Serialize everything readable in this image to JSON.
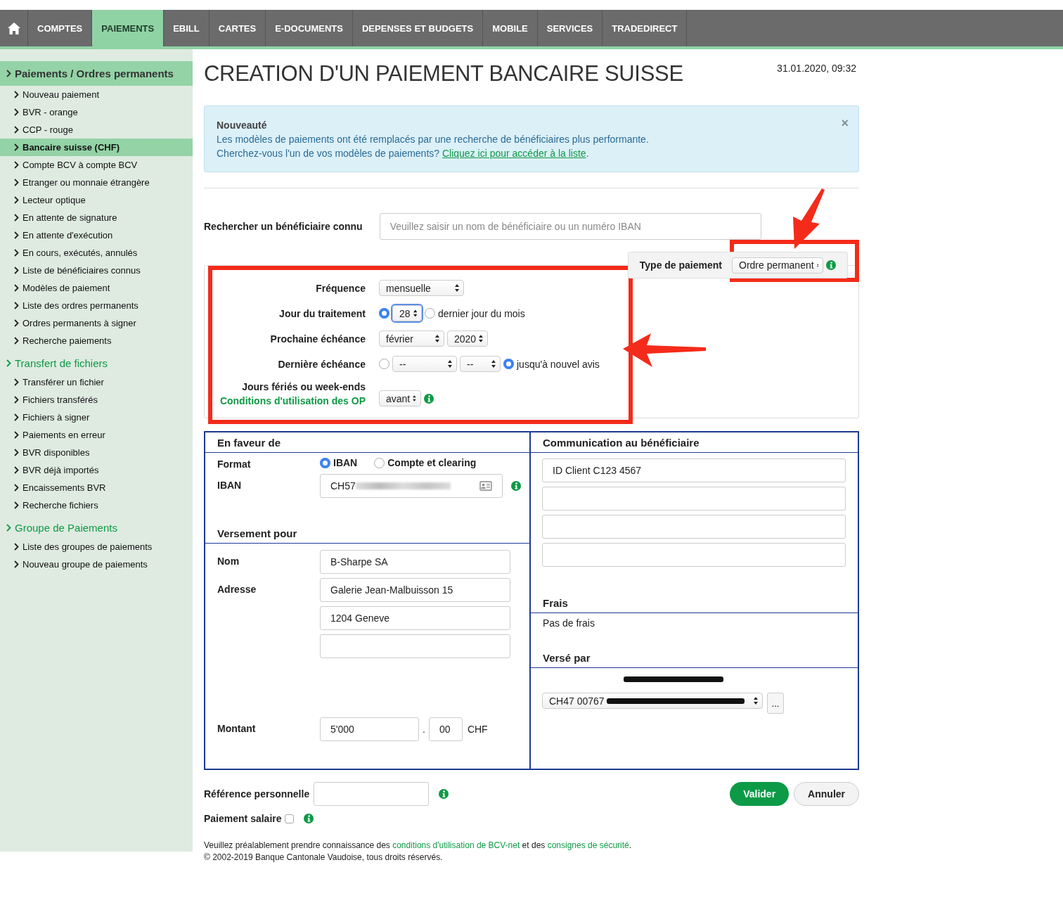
{
  "nav": {
    "items": [
      {
        "label": "COMPTES",
        "selected": false
      },
      {
        "label": "PAIEMENTS",
        "selected": true
      },
      {
        "label": "EBILL",
        "selected": false
      },
      {
        "label": "CARTES",
        "selected": false
      },
      {
        "label": "E-DOCUMENTS",
        "selected": false
      },
      {
        "label": "DEPENSES ET BUDGETS",
        "selected": false
      },
      {
        "label": "MOBILE",
        "selected": false
      },
      {
        "label": "SERVICES",
        "selected": false
      },
      {
        "label": "TRADEDIRECT",
        "selected": false
      }
    ]
  },
  "sidebar": {
    "sections": [
      {
        "title": "Paiements / Ordres permanents",
        "selected": true,
        "items": [
          {
            "label": "Nouveau paiement",
            "selected": false
          },
          {
            "label": "BVR - orange",
            "selected": false
          },
          {
            "label": "CCP - rouge",
            "selected": false
          },
          {
            "label": "Bancaire suisse (CHF)",
            "selected": true
          },
          {
            "label": "Compte BCV à compte BCV",
            "selected": false
          },
          {
            "label": "Etranger ou monnaie étrangère",
            "selected": false
          },
          {
            "label": "Lecteur optique",
            "selected": false
          },
          {
            "label": "En attente de signature",
            "selected": false
          },
          {
            "label": "En attente d'exécution",
            "selected": false
          },
          {
            "label": "En cours, exécutés, annulés",
            "selected": false
          },
          {
            "label": "Liste de bénéficiaires connus",
            "selected": false
          },
          {
            "label": "Modèles de paiement",
            "selected": false
          },
          {
            "label": "Liste des ordres permanents",
            "selected": false
          },
          {
            "label": "Ordres permanents à signer",
            "selected": false
          },
          {
            "label": "Recherche paiements",
            "selected": false
          }
        ]
      },
      {
        "title": "Transfert de fichiers",
        "selected": false,
        "items": [
          {
            "label": "Transférer un fichier",
            "selected": false
          },
          {
            "label": "Fichiers transférés",
            "selected": false
          },
          {
            "label": "Fichiers à signer",
            "selected": false
          },
          {
            "label": "Paiements en erreur",
            "selected": false
          },
          {
            "label": "BVR disponibles",
            "selected": false
          },
          {
            "label": "BVR déjà importés",
            "selected": false
          },
          {
            "label": "Encaissements BVR",
            "selected": false
          },
          {
            "label": "Recherche fichiers",
            "selected": false
          }
        ]
      },
      {
        "title": "Groupe de Paiements",
        "selected": false,
        "items": [
          {
            "label": "Liste des groupes de paiements",
            "selected": false
          },
          {
            "label": "Nouveau groupe de paiements",
            "selected": false
          }
        ]
      }
    ]
  },
  "page": {
    "title": "CREATION D'UN PAIEMENT BANCAIRE SUISSE",
    "timestamp": "31.01.2020, 09:32"
  },
  "notice": {
    "title": "Nouveauté",
    "line1": "Les modèles de paiements ont été remplacés par une recherche de bénéficiaires plus performante.",
    "line2": "Cherchez-vous l'un de vos modèles de paiements?",
    "link": "Cliquez ici pour accéder à la liste",
    "end": ".",
    "close": "×"
  },
  "search": {
    "label": "Rechercher un bénéficiaire connu",
    "placeholder": "Veuillez saisir un nom de bénéficiaire ou un numéro IBAN"
  },
  "payment_type": {
    "label": "Type de paiement",
    "value": "Ordre permanent"
  },
  "standing_order": {
    "frequency": {
      "label": "Fréquence",
      "value": "mensuelle"
    },
    "processing_day": {
      "label": "Jour du traitement",
      "day": {
        "selected": true,
        "value": "28"
      },
      "last_day": {
        "selected": false,
        "label": "dernier jour du mois"
      }
    },
    "next_due": {
      "label": "Prochaine échéance",
      "month": "février",
      "year": "2020"
    },
    "last_due": {
      "label": "Dernière échéance",
      "date": {
        "selected": false,
        "month": "--",
        "year": "--"
      },
      "until_notice": {
        "selected": true,
        "label": "jusqu'à nouvel avis"
      }
    },
    "holidays": {
      "label": "Jours fériés ou week-ends",
      "link": "Conditions d'utilisation des OP",
      "value": "avant"
    }
  },
  "beneficiary": {
    "title": "En faveur de",
    "format": {
      "label": "Format",
      "options": [
        {
          "label": "IBAN",
          "selected": true
        },
        {
          "label": "Compte et clearing",
          "selected": false
        }
      ]
    },
    "iban": {
      "label": "IBAN",
      "value": "CH57"
    },
    "payment_for": {
      "title": "Versement pour",
      "name": {
        "label": "Nom",
        "value": "B-Sharpe SA"
      },
      "address": {
        "label": "Adresse",
        "lines": [
          "Galerie Jean-Malbuisson 15",
          "1204 Geneve"
        ]
      }
    },
    "amount": {
      "label": "Montant",
      "value": "5'000",
      "separator": ".",
      "cents": "00",
      "currency": "CHF"
    }
  },
  "communication": {
    "title": "Communication au bénéficiaire",
    "lines": [
      "ID Client C123 4567"
    ]
  },
  "fees": {
    "title": "Frais",
    "value": "Pas de frais"
  },
  "paid_by": {
    "title": "Versé par",
    "account": "CH47 00767",
    "more": "..."
  },
  "reference": {
    "label": "Référence personnelle"
  },
  "salary": {
    "label": "Paiement salaire",
    "checked": false
  },
  "buttons": [
    {
      "label": "Valider",
      "kind": "primary"
    },
    {
      "label": "Annuler",
      "kind": "secondary"
    }
  ],
  "footer": {
    "before": "Veuillez préalablement prendre connaissance des",
    "link1": "conditions d'utilisation de BCV-net",
    "middle": "et des",
    "link2": "consignes de sécurité",
    "end": ".",
    "copyright": "© 2002-2019 Banque Cantonale Vaudoise, tous droits réservés."
  }
}
